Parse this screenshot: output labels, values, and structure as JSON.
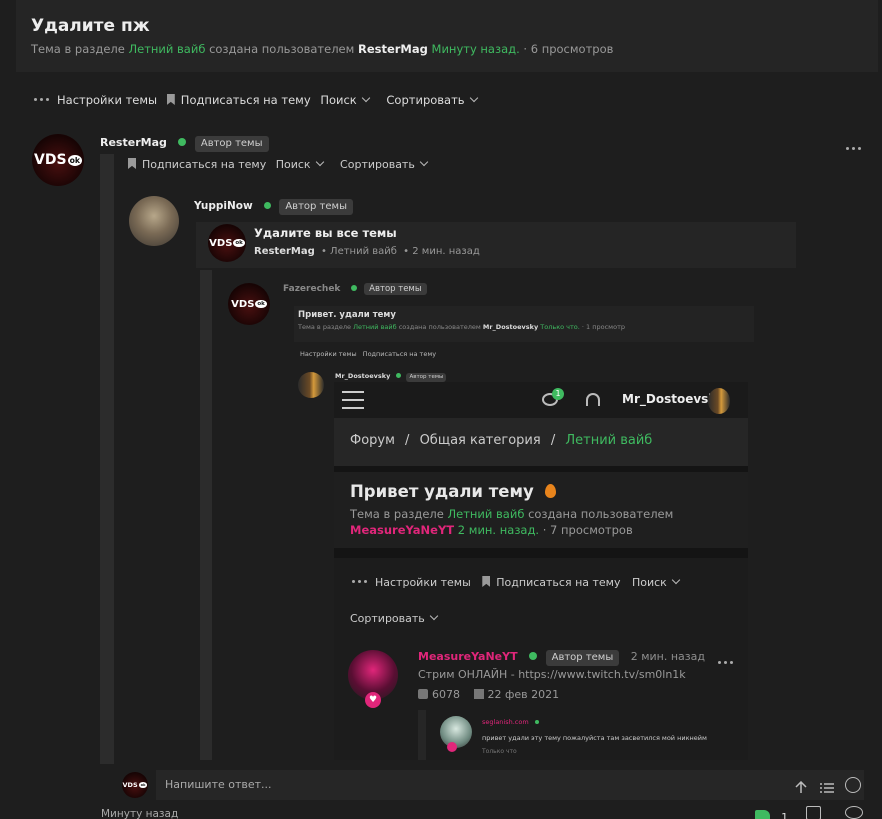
{
  "thread": {
    "title": "Удалите пж",
    "meta_prefix": "Тема в разделе",
    "section": "Летний вайб",
    "meta_mid": "создана пользователем",
    "author": "ResterMag",
    "time": "Минуту назад.",
    "views": "· 6 просмотров"
  },
  "toolbar": {
    "settings": "Настройки темы",
    "subscribe": "Подписаться на тему",
    "search": "Поиск",
    "sort": "Сортировать"
  },
  "post": {
    "author": "ResterMag",
    "badge": "Автор темы",
    "avatar_text": "VDS",
    "avatar_badge": "ok",
    "sub_toolbar": {
      "subscribe": "Подписаться на тему",
      "search": "Поиск",
      "sort": "Сортировать"
    },
    "time": "Минуту назад",
    "likes": "1"
  },
  "quote1": {
    "author": "YuppiNow",
    "badge": "Автор темы",
    "inner_title": "Удалите вы все темы",
    "inner_author": "ResterMag",
    "inner_section": "• Летний вайб",
    "inner_time": "• 2 мин. назад"
  },
  "quote2": {
    "author": "Fazerechek",
    "badge": "Автор темы",
    "title": "Привет. удали тему",
    "meta_prefix": "Тема в разделе",
    "section": "Летний вайб",
    "meta_mid": "создана пользователем",
    "author_user": "Mr_Dostoevsky",
    "time": "Только что.",
    "views": "· 1 просмотр",
    "toolbar_settings": "Настройки темы",
    "toolbar_subscribe": "Подписаться на тему",
    "nested_author": "Mr_Dostoevsky",
    "nested_badge": "Автор темы"
  },
  "phone": {
    "notif_count": "1",
    "username": "Mr_Dostoevsky",
    "breadcrumb_forum": "Форум",
    "breadcrumb_sep": "/",
    "breadcrumb_category": "Общая категория",
    "breadcrumb_section": "Летний вайб",
    "title": "Привет удали тему",
    "meta_prefix": "Тема в разделе",
    "section": "Летний вайб",
    "meta_mid": "создана пользователем",
    "author": "MeasureYaNeYT",
    "time": "2 мин. назад.",
    "views": "· 7 просмотров",
    "toolbar_settings": "Настройки темы",
    "toolbar_subscribe": "Подписаться на тему",
    "toolbar_search": "Поиск",
    "toolbar_sort": "Сортировать",
    "post_author": "MeasureYaNeYT",
    "post_badge": "Автор темы",
    "post_time": "2 мин. назад",
    "post_status": "Стрим ОНЛАЙН - https://www.twitch.tv/sm0ln1k",
    "post_count": "6078",
    "post_date": "22 фев 2021",
    "reply_author": "seglanish.com",
    "reply_text": "привет удали эту тему пожалуйста там засветился мой никнейм",
    "reply_time": "Только что"
  },
  "reply": {
    "placeholder": "Напишите ответ..."
  },
  "colors": {
    "accent": "#3fba60",
    "pink": "#e0267a",
    "bg": "#1e1e1e"
  }
}
